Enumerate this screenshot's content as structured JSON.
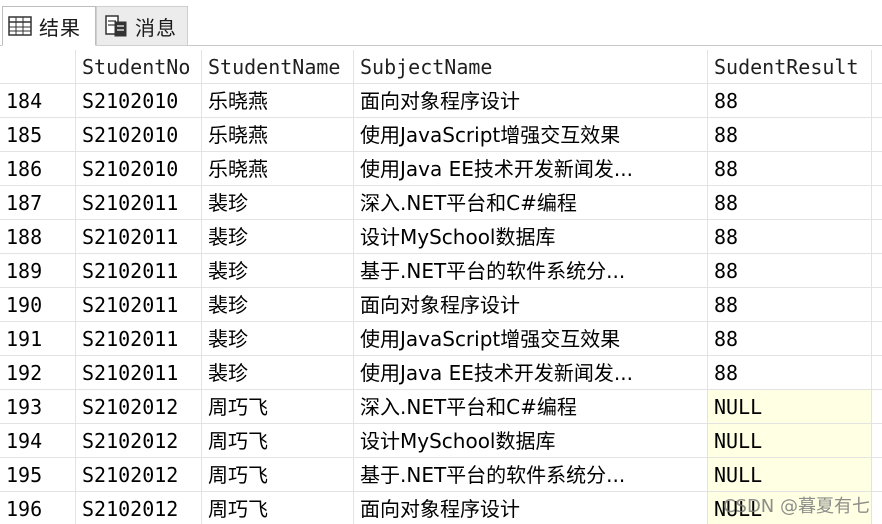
{
  "tabs": {
    "results_label": "结果",
    "messages_label": "消息"
  },
  "grid": {
    "columns": [
      "",
      "StudentNo",
      "StudentName",
      "SubjectName",
      "SudentResult"
    ],
    "rows": [
      [
        "184",
        "S2102010",
        "乐晓燕",
        "面向对象程序设计",
        "88"
      ],
      [
        "185",
        "S2102010",
        "乐晓燕",
        "使用JavaScript增强交互效果",
        "88"
      ],
      [
        "186",
        "S2102010",
        "乐晓燕",
        "使用Java EE技术开发新闻发...",
        "88"
      ],
      [
        "187",
        "S2102011",
        "裴珍",
        "深入.NET平台和C#编程",
        "88"
      ],
      [
        "188",
        "S2102011",
        "裴珍",
        "设计MySchool数据库",
        "88"
      ],
      [
        "189",
        "S2102011",
        "裴珍",
        "基于.NET平台的软件系统分...",
        "88"
      ],
      [
        "190",
        "S2102011",
        "裴珍",
        "面向对象程序设计",
        "88"
      ],
      [
        "191",
        "S2102011",
        "裴珍",
        "使用JavaScript增强交互效果",
        "88"
      ],
      [
        "192",
        "S2102011",
        "裴珍",
        "使用Java EE技术开发新闻发...",
        "88"
      ],
      [
        "193",
        "S2102012",
        "周巧飞",
        "深入.NET平台和C#编程",
        "NULL"
      ],
      [
        "194",
        "S2102012",
        "周巧飞",
        "设计MySchool数据库",
        "NULL"
      ],
      [
        "195",
        "S2102012",
        "周巧飞",
        "基于.NET平台的软件系统分...",
        "NULL"
      ],
      [
        "196",
        "S2102012",
        "周巧飞",
        "面向对象程序设计",
        "NULL"
      ]
    ]
  },
  "watermark": "CSDN @暮夏有七",
  "colors": {
    "null_cell_bg": "#ffffe3",
    "grid_line": "#e3e3e3"
  },
  "icons": {
    "results_tab": "grid-icon",
    "messages_tab": "message-document-icon"
  }
}
